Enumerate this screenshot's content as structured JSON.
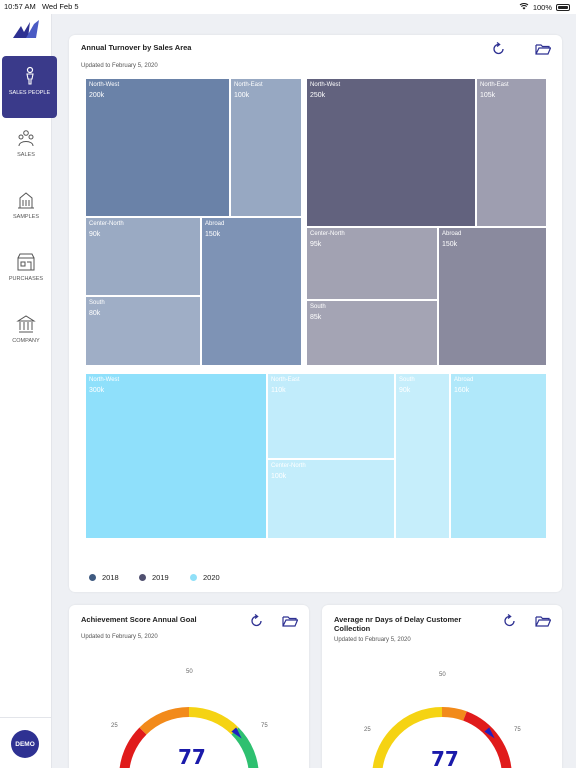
{
  "status_bar": {
    "time": "10:57 AM",
    "date": "Wed Feb 5",
    "battery": "100%"
  },
  "sidebar": {
    "items": [
      {
        "label": "SALES PEOPLE",
        "icon": "person-icon",
        "active": true
      },
      {
        "label": "SALES",
        "icon": "people-icon",
        "active": false
      },
      {
        "label": "SAMPLES",
        "icon": "building-icon",
        "active": false
      },
      {
        "label": "PURCHASES",
        "icon": "shop-icon",
        "active": false
      },
      {
        "label": "COMPANY",
        "icon": "bank-icon",
        "active": false
      }
    ],
    "demo_label": "DEMO"
  },
  "turnover_card": {
    "title": "Annual Turnover by Sales Area",
    "updated": "Updated to  February 5, 2020",
    "legend": [
      {
        "label": "2018",
        "color": "#3f5a80"
      },
      {
        "label": "2019",
        "color": "#505070"
      },
      {
        "label": "2020",
        "color": "#90e0f8"
      }
    ],
    "tiles": [
      {
        "area": "North-West",
        "value": "200k",
        "color": "#6a82a8"
      },
      {
        "area": "North-East",
        "value": "100k",
        "color": "#97a8c2"
      },
      {
        "area": "Center-North",
        "value": "90k",
        "color": "#9aaac3"
      },
      {
        "area": "Abroad",
        "value": "150k",
        "color": "#7e93b5"
      },
      {
        "area": "South",
        "value": "80k",
        "color": "#9faec6"
      },
      {
        "area": "North-West",
        "value": "250k",
        "color": "#62627e"
      },
      {
        "area": "North-East",
        "value": "105k",
        "color": "#9e9eb0"
      },
      {
        "area": "Center-North",
        "value": "95k",
        "color": "#a2a2b2"
      },
      {
        "area": "Abroad",
        "value": "150k",
        "color": "#8a8a9e"
      },
      {
        "area": "South",
        "value": "85k",
        "color": "#a4a4b4"
      },
      {
        "area": "North-West",
        "value": "300k",
        "color": "#8fe0fb"
      },
      {
        "area": "North-East",
        "value": "110k",
        "color": "#c1ecfb"
      },
      {
        "area": "Center-North",
        "value": "100k",
        "color": "#c3edfb"
      },
      {
        "area": "South",
        "value": "90k",
        "color": "#c6eefb"
      },
      {
        "area": "Abroad",
        "value": "160k",
        "color": "#b0e8fa"
      }
    ]
  },
  "score_card": {
    "title": "Achievement Score Annual Goal",
    "updated": "Updated to  February 5, 2020",
    "ticks": {
      "t25": "25",
      "t50": "50",
      "t75": "75"
    },
    "value": "77",
    "value_fraction": 0.77
  },
  "delay_card": {
    "title_line1": "Average nr Days of Delay Customer",
    "title_line2": "Collection",
    "updated": "Updated to  February 5, 2020",
    "ticks": {
      "t25": "25",
      "t50": "50",
      "t75": "75"
    },
    "value": "77",
    "value_fraction": 0.77
  }
}
